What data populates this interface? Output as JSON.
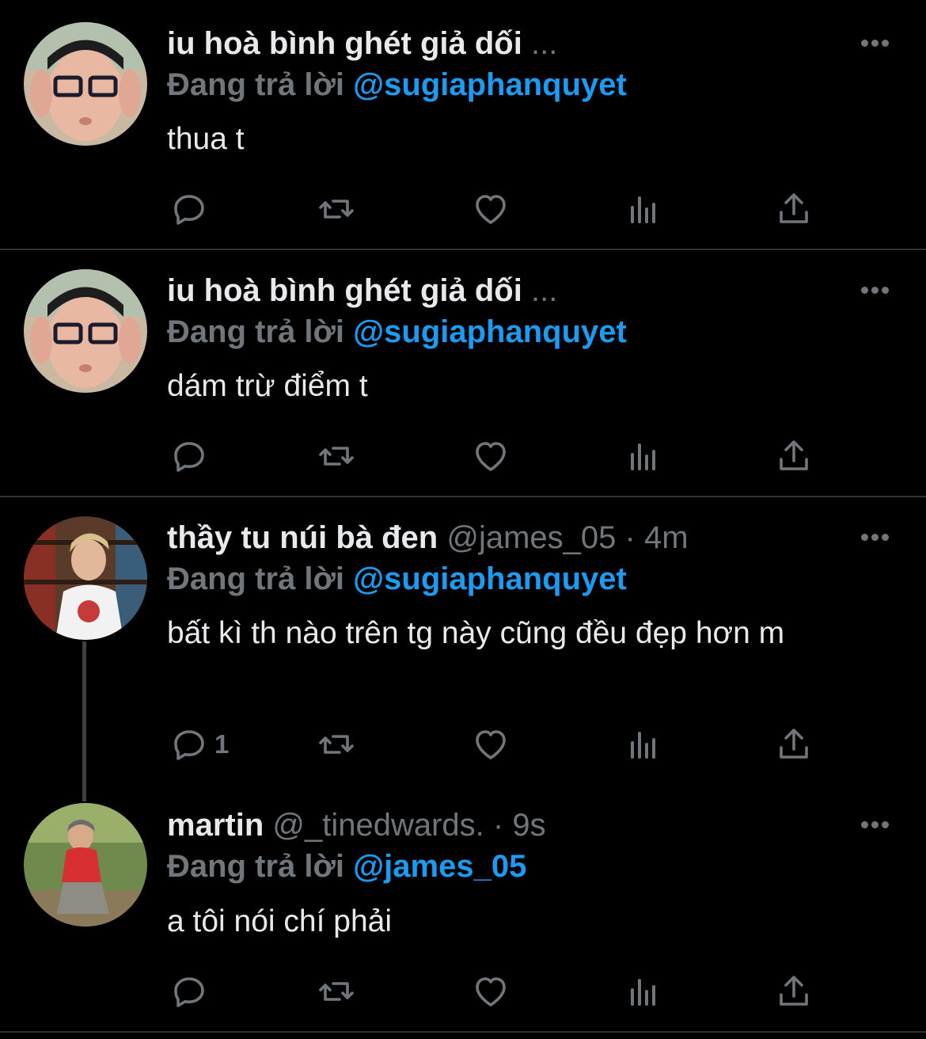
{
  "colors": {
    "background": "#000000",
    "text": "#e7e9ea",
    "muted": "#71767b",
    "accent": "#1d9bf0",
    "divider": "#2f3336"
  },
  "tweets": [
    {
      "name": "iu hoà bình ghét giả dối",
      "handle": "",
      "time": "",
      "truncated": "...",
      "reply_prefix": "Đang trả lời",
      "reply_to": "@sugiaphanquyet",
      "text": "thua t",
      "reply_count": "",
      "icons": [
        "reply-icon",
        "retweet-icon",
        "like-icon",
        "views-icon",
        "share-icon"
      ]
    },
    {
      "name": "iu hoà bình ghét giả dối",
      "handle": "",
      "time": "",
      "truncated": "...",
      "reply_prefix": "Đang trả lời",
      "reply_to": "@sugiaphanquyet",
      "text": "dám trừ điểm t",
      "reply_count": ""
    },
    {
      "name": "thầy tu núi bà đen",
      "handle": "@james_05",
      "dot": "·",
      "time": "4m",
      "reply_prefix": "Đang trả lời",
      "reply_to": "@sugiaphanquyet",
      "text": "bất kì th nào trên tg này cũng đều đẹp hơn m",
      "reply_count": "1"
    },
    {
      "name": "martin",
      "handle": "@_tinedwards.",
      "dot": "·",
      "time": "9s",
      "reply_prefix": "Đang trả lời",
      "reply_to": "@james_05",
      "text": "a tôi nói chí phải",
      "reply_count": ""
    }
  ]
}
